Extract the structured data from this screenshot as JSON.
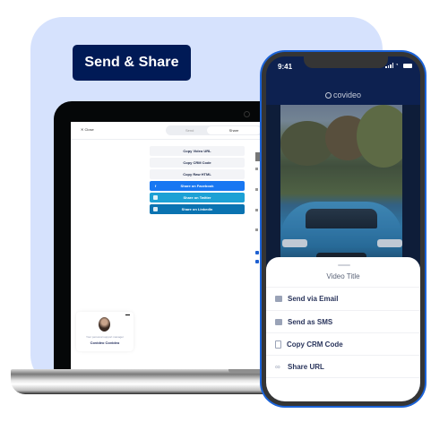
{
  "header": {
    "title": "Send & Share"
  },
  "laptop": {
    "topbar": {
      "close_label": "✕ Close",
      "tabs": [
        {
          "label": "Send",
          "active": false
        },
        {
          "label": "Share",
          "active": true
        }
      ]
    },
    "share_buttons": [
      {
        "label": "Copy Video URL",
        "style": "grey",
        "icon": ""
      },
      {
        "label": "Copy CRM Code",
        "style": "grey",
        "icon": ""
      },
      {
        "label": "Copy Raw HTML",
        "style": "grey",
        "icon": ""
      },
      {
        "label": "Share on Facebook",
        "style": "fb",
        "icon": "f"
      },
      {
        "label": "Share on Twitter",
        "style": "tw",
        "icon": "t"
      },
      {
        "label": "Share on LinkedIn",
        "style": "li",
        "icon": "in"
      }
    ],
    "support_card": {
      "caption": "Your personal support manager",
      "name": "Covideo Covideo"
    }
  },
  "phone": {
    "status": {
      "time": "9:41"
    },
    "logo": "covideo",
    "sheet": {
      "title": "Video Title",
      "items": [
        {
          "label": "Send via Email",
          "icon": "mail-icon"
        },
        {
          "label": "Send as SMS",
          "icon": "sms-icon"
        },
        {
          "label": "Copy CRM Code",
          "icon": "copy-icon"
        },
        {
          "label": "Share URL",
          "icon": "link-icon"
        }
      ]
    }
  },
  "colors": {
    "brand_navy": "#001a56",
    "background_card": "#d6e2fd",
    "phone_frame": "#1b63d8",
    "facebook": "#1877f2",
    "twitter": "#1da1d5",
    "linkedin": "#0a73b1"
  }
}
